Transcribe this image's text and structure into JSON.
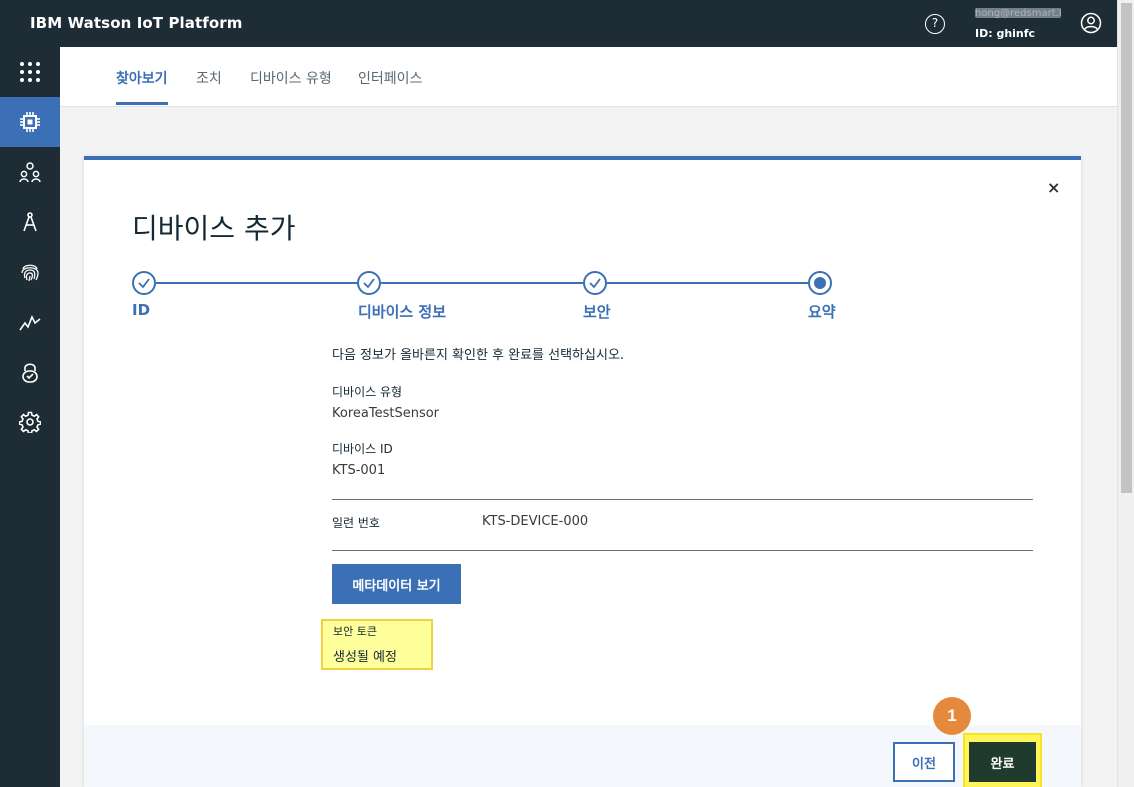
{
  "app": {
    "title": "IBM Watson IoT Platform",
    "account_email": "hong@redsmart.kr",
    "account_id": "ID: ghinfc",
    "help_icon": "help-icon",
    "user_icon": "user-icon"
  },
  "sidebar": {
    "items": [
      {
        "icon": "apps-grid-icon",
        "active": false
      },
      {
        "icon": "devices-chip-icon",
        "active": true
      },
      {
        "icon": "members-icon",
        "active": false
      },
      {
        "icon": "apps-compass-icon",
        "active": false
      },
      {
        "icon": "fingerprint-icon",
        "active": false
      },
      {
        "icon": "usage-chart-icon",
        "active": false
      },
      {
        "icon": "security-lock-icon",
        "active": false
      },
      {
        "icon": "settings-gear-icon",
        "active": false
      }
    ]
  },
  "tabs": [
    "찾아보기",
    "조치",
    "디바이스 유형",
    "인터페이스"
  ],
  "dialog": {
    "title": "디바이스 추가",
    "close_symbol": "×",
    "steps": [
      "ID",
      "디바이스 정보",
      "보안",
      "요약"
    ],
    "instruction": "다음 정보가 올바른지 확인한 후 완료를 선택하십시오.",
    "device_type_label": "디바이스 유형",
    "device_type_value": "KoreaTestSensor",
    "device_id_label": "디바이스 ID",
    "device_id_value": "KTS-001",
    "serial_label": "일련 번호",
    "serial_value": "KTS-DEVICE-000",
    "metadata_button": "메타데이터 보기",
    "token_label": "보안 토큰",
    "token_value": "생성될 예정",
    "prev_button": "이전",
    "done_button": "완료"
  },
  "annotation": {
    "step_number": "1",
    "color": "#e58a3c"
  },
  "colors": {
    "accent": "#3b6fb6",
    "nav_bg": "#1d2c35",
    "highlight": "#ffff9b"
  }
}
